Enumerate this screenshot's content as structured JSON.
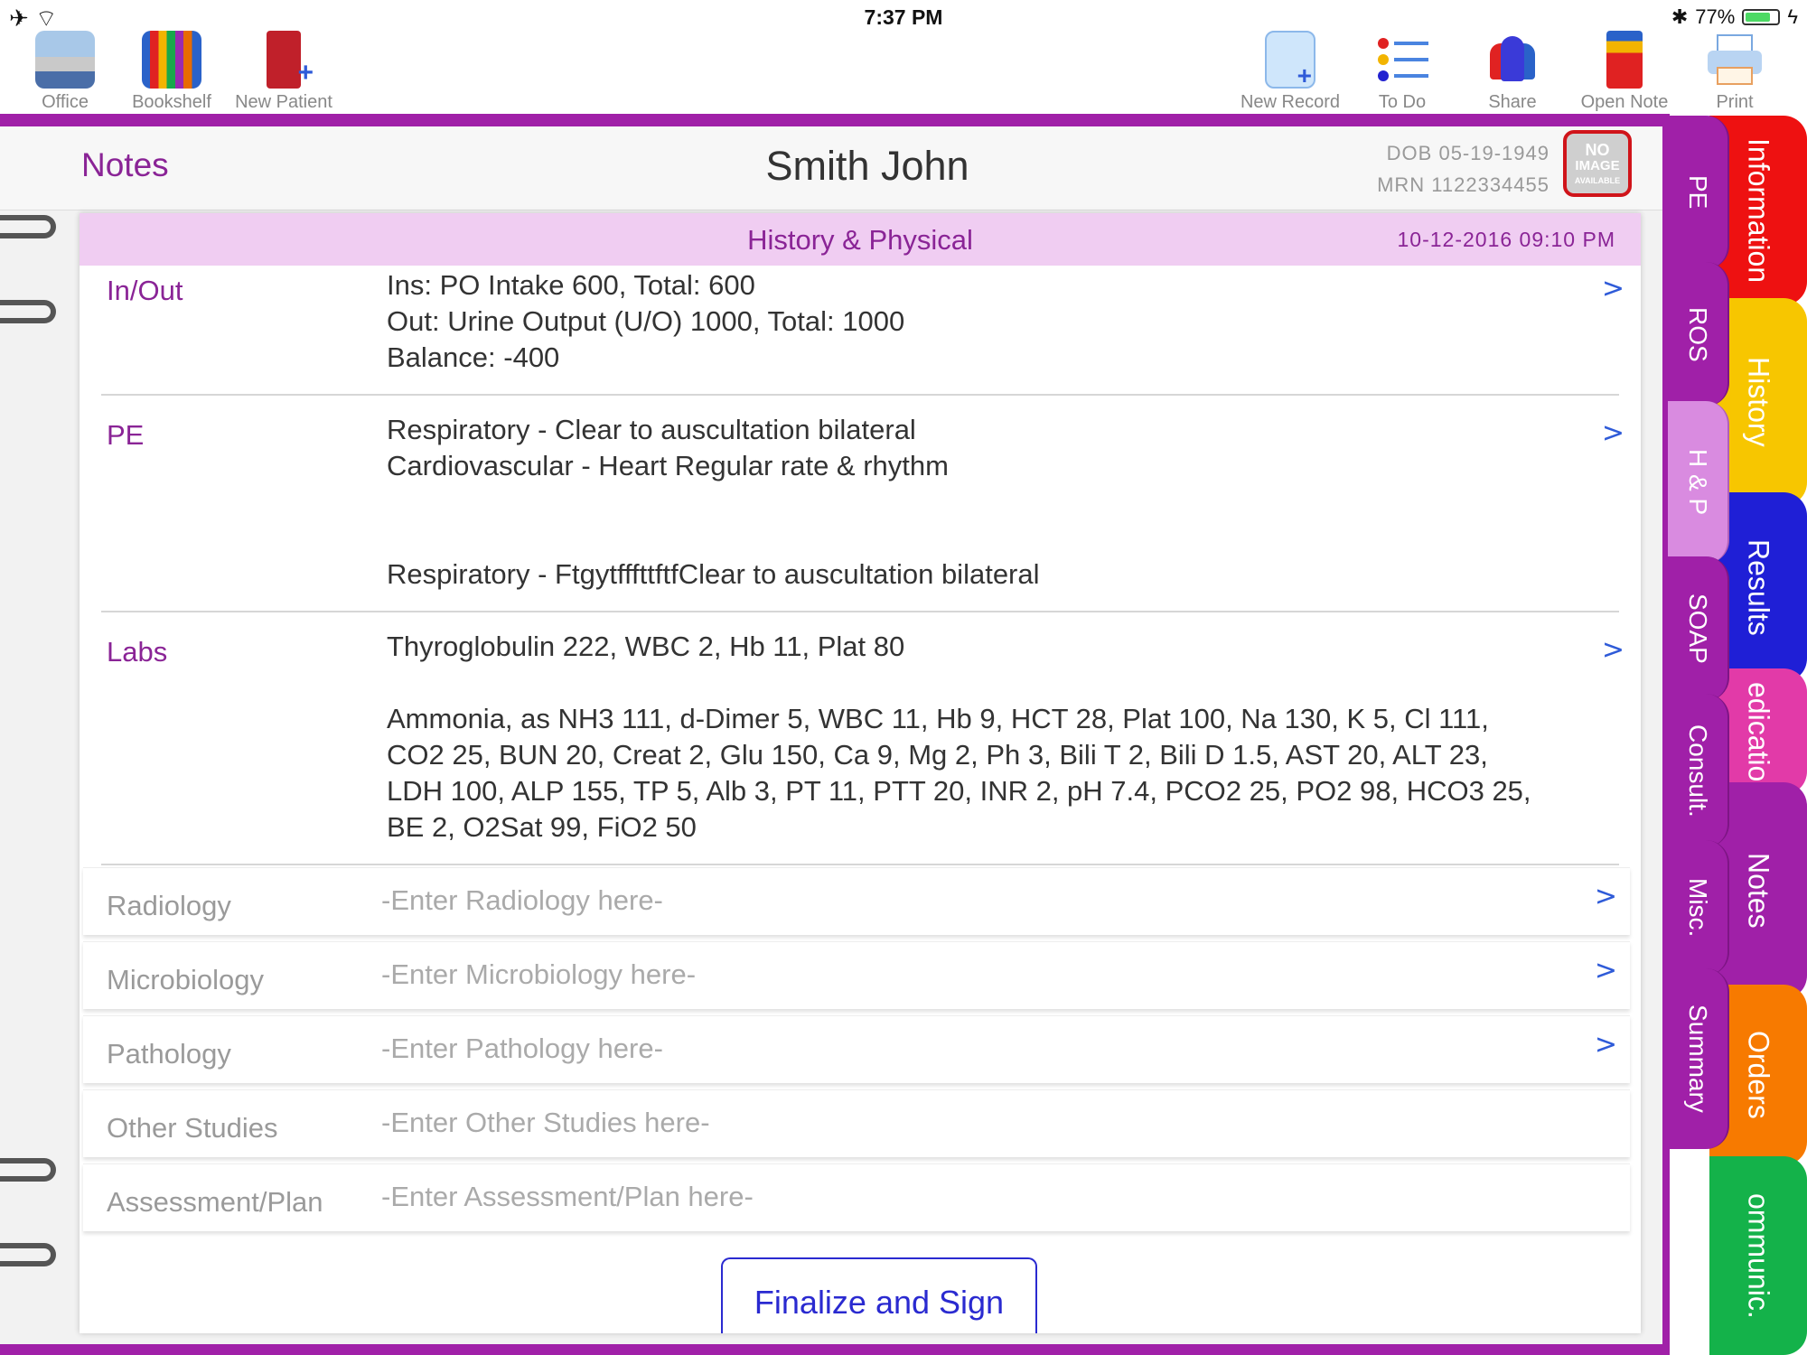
{
  "status": {
    "time": "7:37 PM",
    "battery": "77%",
    "battery_level": 0.77
  },
  "toolbar": {
    "office": "Office",
    "bookshelf": "Bookshelf",
    "new_patient": "New Patient",
    "new_record": "New Record",
    "to_do": "To Do",
    "share": "Share",
    "open_note": "Open Note",
    "print": "Print"
  },
  "header": {
    "section": "Notes",
    "patient_name": "Smith John",
    "dob": "DOB 05-19-1949",
    "mrn": "MRN 1122334455",
    "no_image": [
      "NO",
      "IMAGE",
      "AVAILABLE"
    ]
  },
  "note": {
    "title": "History & Physical",
    "datetime": "10-12-2016 09:10 PM",
    "rows": [
      {
        "label": "In/Out",
        "lines": [
          "Ins: PO Intake 600, Total: 600",
          "Out: Urine Output (U/O) 1000, Total: 1000",
          "Balance: -400"
        ]
      },
      {
        "label": "PE",
        "lines": [
          "Respiratory - Clear to auscultation bilateral",
          "Cardiovascular - Heart Regular rate & rhythm",
          "",
          "",
          "Respiratory - FtgytfffttftfClear to auscultation bilateral"
        ]
      },
      {
        "label": "Labs",
        "lines": [
          "Thyroglobulin 222, WBC 2, Hb 11, Plat 80",
          "",
          "Ammonia, as NH3 111, d-Dimer 5, WBC 11, Hb 9, HCT 28, Plat 100, Na 130, K 5, Cl 111,",
          "CO2 25, BUN 20, Creat 2, Glu 150, Ca 9, Mg 2, Ph 3, Bili T 2, Bili D 1.5, AST 20, ALT 23,",
          "LDH 100, ALP 155, TP 5, Alb 3, PT 11, PTT 20, INR 2, pH 7.4, PCO2 25, PO2 98, HCO3 25,",
          "BE 2, O2Sat 99, FiO2 50"
        ]
      }
    ],
    "empty_rows": [
      {
        "label": "Radiology",
        "placeholder": "-Enter Radiology here-"
      },
      {
        "label": "Microbiology",
        "placeholder": "-Enter Microbiology here-"
      },
      {
        "label": "Pathology",
        "placeholder": "-Enter Pathology here-"
      },
      {
        "label": "Other Studies",
        "placeholder": "-Enter Other Studies here-"
      },
      {
        "label": "Assessment/Plan",
        "placeholder": "-Enter Assessment/Plan here-"
      }
    ],
    "chevron": ">",
    "finalize": "Finalize and Sign"
  },
  "inner_tabs": [
    "PE",
    "ROS",
    "H & P",
    "SOAP",
    "Consult.",
    "Misc.",
    "Summary"
  ],
  "outer_tabs": [
    "Information",
    "History",
    "Results",
    "edicatio",
    "Notes",
    "Orders",
    "ommunic."
  ],
  "colors": {
    "accent_purple": "#a020a8",
    "header_pink": "#f0cdf2",
    "link_blue": "#2f5bd8",
    "tab_information": "#ee1111",
    "tab_history": "#f7c600",
    "tab_results": "#1f1fd6",
    "tab_medication": "#e23aa8",
    "tab_notes": "#a020a8",
    "tab_orders": "#f77a00",
    "tab_communication": "#14b24a"
  }
}
